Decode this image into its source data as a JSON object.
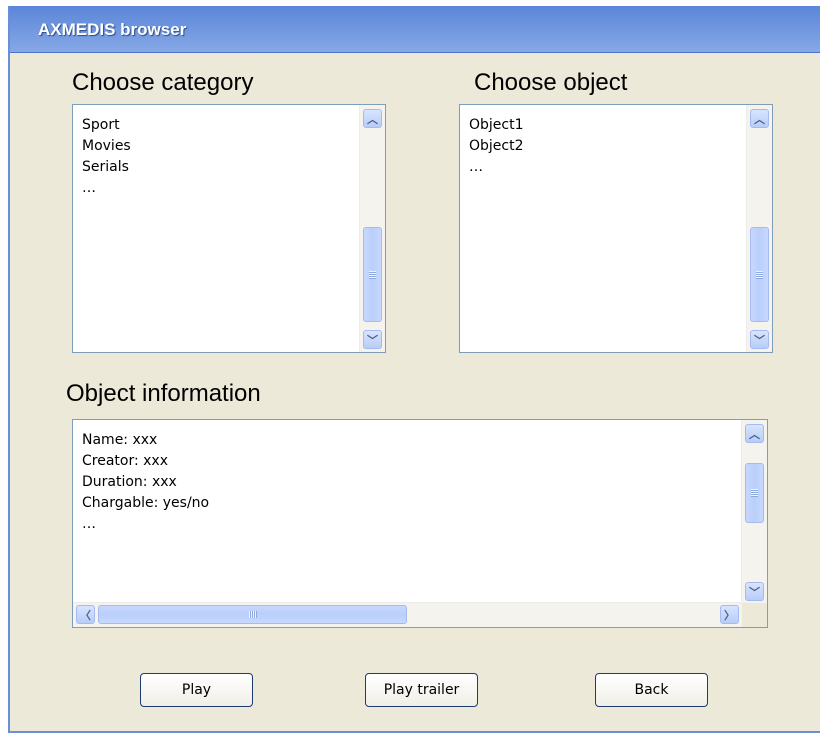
{
  "window": {
    "title": "AXMEDIS browser"
  },
  "category": {
    "heading": "Choose category",
    "items": [
      "Sport",
      "Movies",
      "Serials",
      "…"
    ]
  },
  "object": {
    "heading": "Choose object",
    "items": [
      "Object1",
      "Object2",
      "…"
    ]
  },
  "info": {
    "heading": "Object information",
    "lines": [
      "Name: xxx",
      "Creator: xxx",
      "Duration: xxx",
      "Chargable: yes/no",
      "…"
    ]
  },
  "buttons": {
    "play": "Play",
    "play_trailer": "Play trailer",
    "back": "Back"
  },
  "icons": {
    "scroll_up": "chevron-up-icon",
    "scroll_down": "chevron-down-icon",
    "scroll_left": "chevron-left-icon",
    "scroll_right": "chevron-right-icon"
  },
  "colors": {
    "titlebar": "#6e95de",
    "window_bg": "#ece9d8",
    "scroll_accent": "#b7cdf7"
  }
}
